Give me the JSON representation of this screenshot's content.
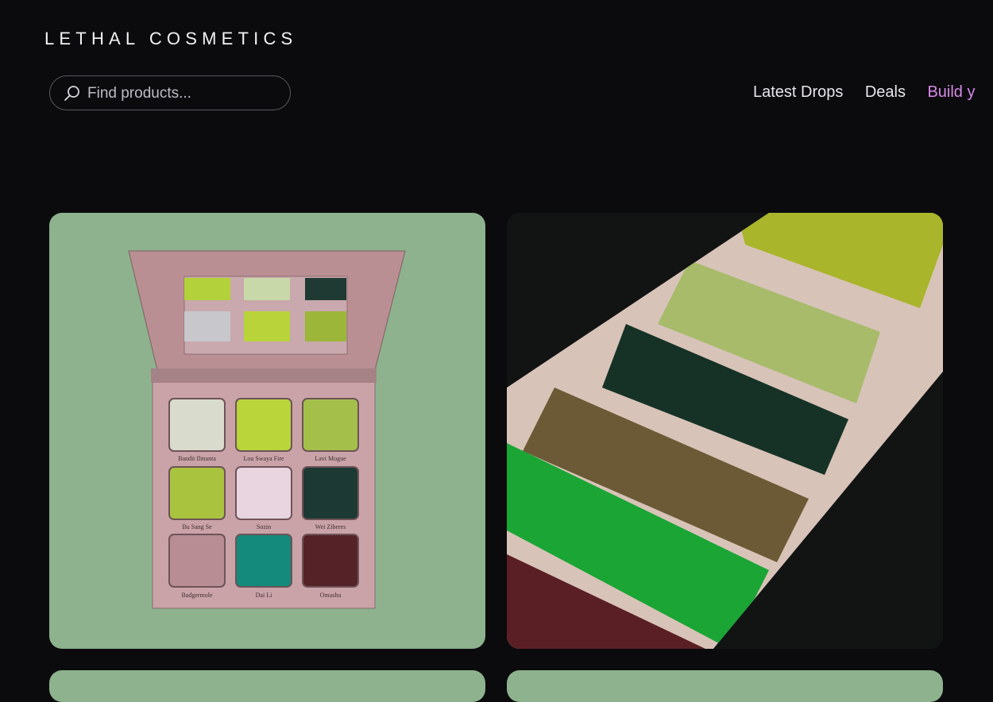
{
  "header": {
    "brand": "LETHAL COSMETICS",
    "search": {
      "placeholder": "Find products...",
      "value": ""
    },
    "nav": [
      {
        "label": "Latest Drops"
      },
      {
        "label": "Deals"
      },
      {
        "label": "Build y"
      }
    ]
  },
  "products": {
    "palette_card": {
      "shades": [
        "Bandit Ilmanta",
        "Lou Swaya Fire",
        "Lavi Mogue",
        "Bu Sang Se",
        "Sozin",
        "Wei Ziberes",
        "Badgermole",
        "Dai Li",
        "Omashu"
      ]
    }
  },
  "colors": {
    "background": "#0b0b0e",
    "accent": "#d98ae8",
    "card_green": "#8db28d"
  }
}
